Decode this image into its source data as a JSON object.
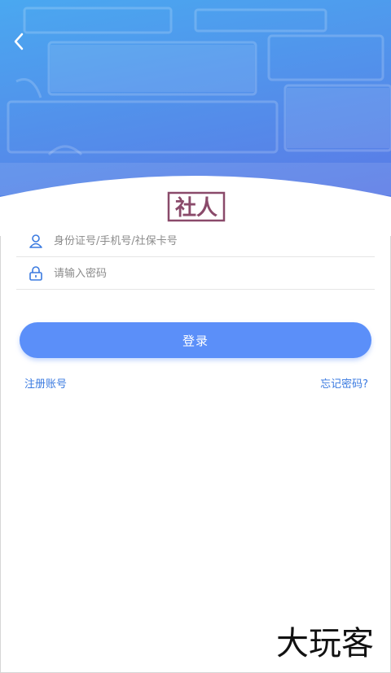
{
  "header": {
    "back_icon": "chevron-left-icon",
    "colors": {
      "gradient_top": "#4aa8f0",
      "gradient_bottom": "#5a7be6"
    }
  },
  "logo": {
    "text": "社人",
    "icon": "shebao-logo-icon",
    "color": "#8a4a6a"
  },
  "form": {
    "account": {
      "icon": "user-icon",
      "placeholder": "身份证号/手机号/社保卡号",
      "value": ""
    },
    "password": {
      "icon": "lock-icon",
      "placeholder": "请输入密码",
      "value": ""
    }
  },
  "login_button": {
    "label": "登录",
    "color": "#5b8ff9"
  },
  "links": {
    "register": "注册账号",
    "forgot": "忘记密码?"
  },
  "watermark": {
    "text": "大玩客"
  }
}
